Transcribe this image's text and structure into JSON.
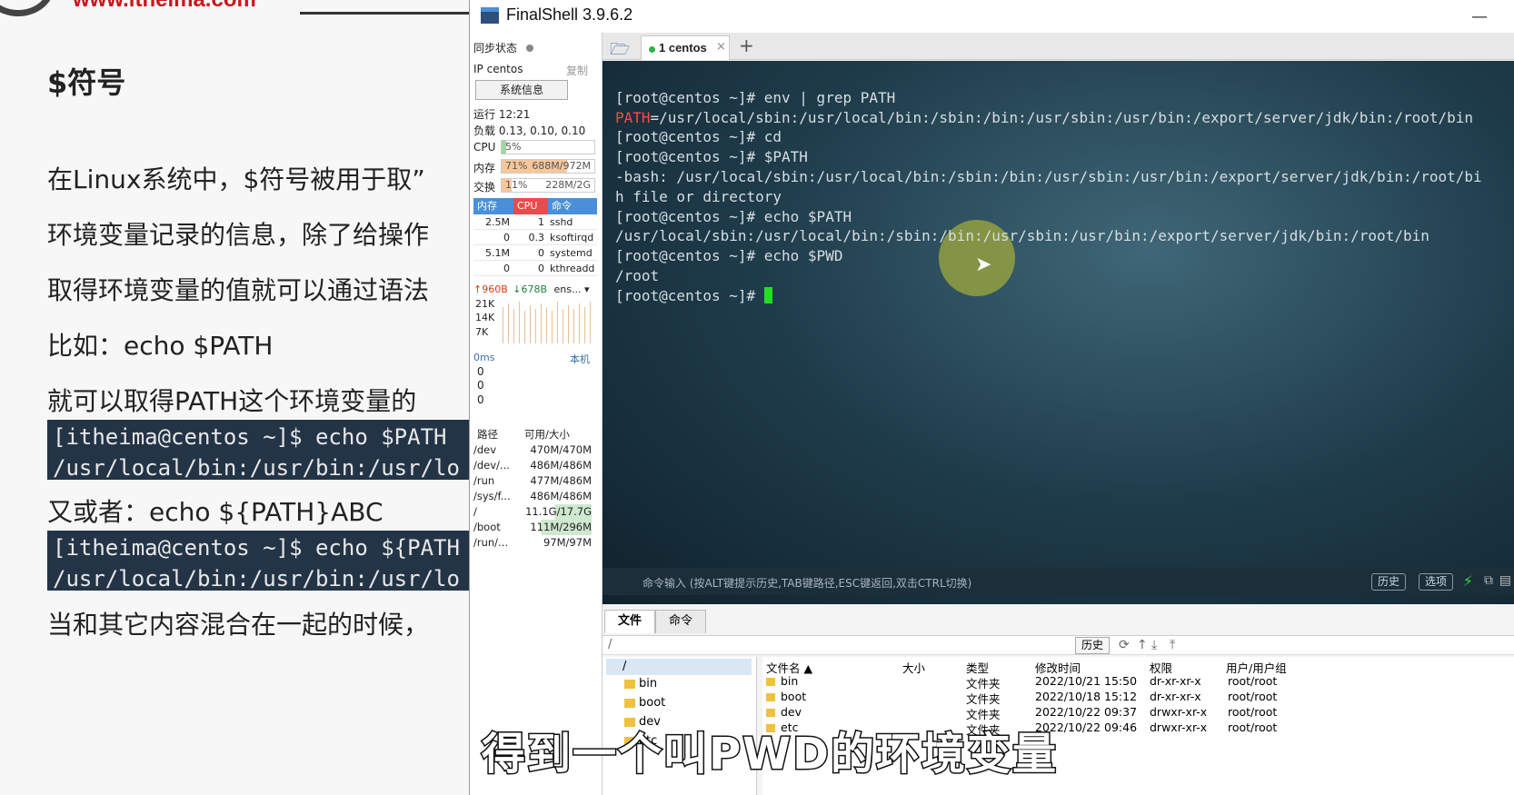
{
  "slide": {
    "logo": "www.itheima.com",
    "heading": "$符号",
    "lines": [
      "在Linux系统中，$符号被用于取”",
      "环境变量记录的信息，除了给操作",
      "取得环境变量的值就可以通过语法",
      "比如：echo $PATH",
      "就可以取得PATH这个环境变量的",
      "又或者：echo ${PATH}ABC",
      "当和其它内容混合在一起的时候，"
    ],
    "code1": [
      "[itheima@centos ~]$ echo $PATH",
      "/usr/local/bin:/usr/bin:/usr/lo"
    ],
    "code2": [
      "[itheima@centos ~]$ echo ${PATH",
      "/usr/local/bin:/usr/bin:/usr/lo"
    ]
  },
  "window": {
    "title": "FinalShell 3.9.6.2",
    "minimize": "—"
  },
  "sidebar": {
    "sync_label": "同步状态",
    "ip_label": "IP centos",
    "copy_label": "复制",
    "sysinfo_button": "系统信息",
    "uptime": "运行 12:21",
    "load": "负载 0.13, 0.10, 0.10",
    "cpu": {
      "label": "CPU",
      "text": "5%",
      "value": 0.05
    },
    "mem": {
      "label": "内存",
      "text": "71%",
      "detail": "688M/972M",
      "value": 0.71
    },
    "swap": {
      "label": "交换",
      "text": "11%",
      "detail": "228M/2G",
      "value": 0.11
    },
    "proc_headers": [
      "内存",
      "CPU",
      "命令"
    ],
    "procs": [
      {
        "mem": "2.5M",
        "cpu": "1",
        "cmd": "sshd"
      },
      {
        "mem": "0",
        "cpu": "0.3",
        "cmd": "ksoftirqd"
      },
      {
        "mem": "5.1M",
        "cpu": "0",
        "cmd": "systemd"
      },
      {
        "mem": "0",
        "cpu": "0",
        "cmd": "kthreadd"
      }
    ],
    "net": {
      "up": "↑960B",
      "down": "↓678B",
      "iface": "ens...",
      "ticks": [
        "21K",
        "14K",
        "7K"
      ]
    },
    "ping": {
      "label": "0ms",
      "host": "本机",
      "values": [
        "0",
        "0",
        "0"
      ]
    },
    "disk_headers": [
      "路径",
      "可用/大小"
    ],
    "disks": [
      {
        "path": "/dev",
        "size": "470M/470M"
      },
      {
        "path": "/dev/...",
        "size": "486M/486M"
      },
      {
        "path": "/run",
        "size": "477M/486M"
      },
      {
        "path": "/sys/f...",
        "size": "486M/486M"
      },
      {
        "path": "/",
        "size": "11.1G/17.7G"
      },
      {
        "path": "/boot",
        "size": "111M/296M"
      },
      {
        "path": "/run/...",
        "size": "97M/97M"
      }
    ]
  },
  "tabs": {
    "session": "1 centos",
    "close": "×",
    "add": "+"
  },
  "terminal": {
    "lines": [
      "[root@centos ~]# env | grep PATH",
      "PATH=/usr/local/sbin:/usr/local/bin:/sbin:/bin:/usr/sbin:/usr/bin:/export/server/jdk/bin:/root/bin",
      "[root@centos ~]# cd",
      "[root@centos ~]# $PATH",
      "-bash: /usr/local/sbin:/usr/local/bin:/sbin:/bin:/usr/sbin:/usr/bin:/export/server/jdk/bin:/root/bi",
      "h file or directory",
      "[root@centos ~]# echo $PATH",
      "/usr/local/sbin:/usr/local/bin:/sbin:/bin:/usr/sbin:/usr/bin:/export/server/jdk/bin:/root/bin",
      "[root@centos ~]# echo $PWD",
      "/root",
      "[root@centos ~]# "
    ],
    "cmd_hint": "命令输入 (按ALT键提示历史,TAB键路径,ESC键返回,双击CTRL切换)",
    "history_btn": "历史",
    "options_btn": "选项"
  },
  "files": {
    "tab_files": "文件",
    "tab_cmd": "命令",
    "path": "/",
    "history_btn": "历史",
    "tree_root": "/",
    "tree": [
      "bin",
      "boot",
      "dev",
      "etc"
    ],
    "headers": [
      "文件名 ▲",
      "大小",
      "类型",
      "修改时间",
      "权限",
      "用户/用户组"
    ],
    "rows": [
      {
        "name": "bin",
        "type": "文件夹",
        "time": "2022/10/21 15:50",
        "perm": "dr-xr-xr-x",
        "owner": "root/root"
      },
      {
        "name": "boot",
        "type": "文件夹",
        "time": "2022/10/18 15:12",
        "perm": "dr-xr-xr-x",
        "owner": "root/root"
      },
      {
        "name": "dev",
        "type": "文件夹",
        "time": "2022/10/22 09:37",
        "perm": "drwxr-xr-x",
        "owner": "root/root"
      },
      {
        "name": "etc",
        "type": "文件夹",
        "time": "2022/10/22 09:46",
        "perm": "drwxr-xr-x",
        "owner": "root/root"
      }
    ]
  },
  "subtitle": "得到一个叫PWD的环境变量"
}
